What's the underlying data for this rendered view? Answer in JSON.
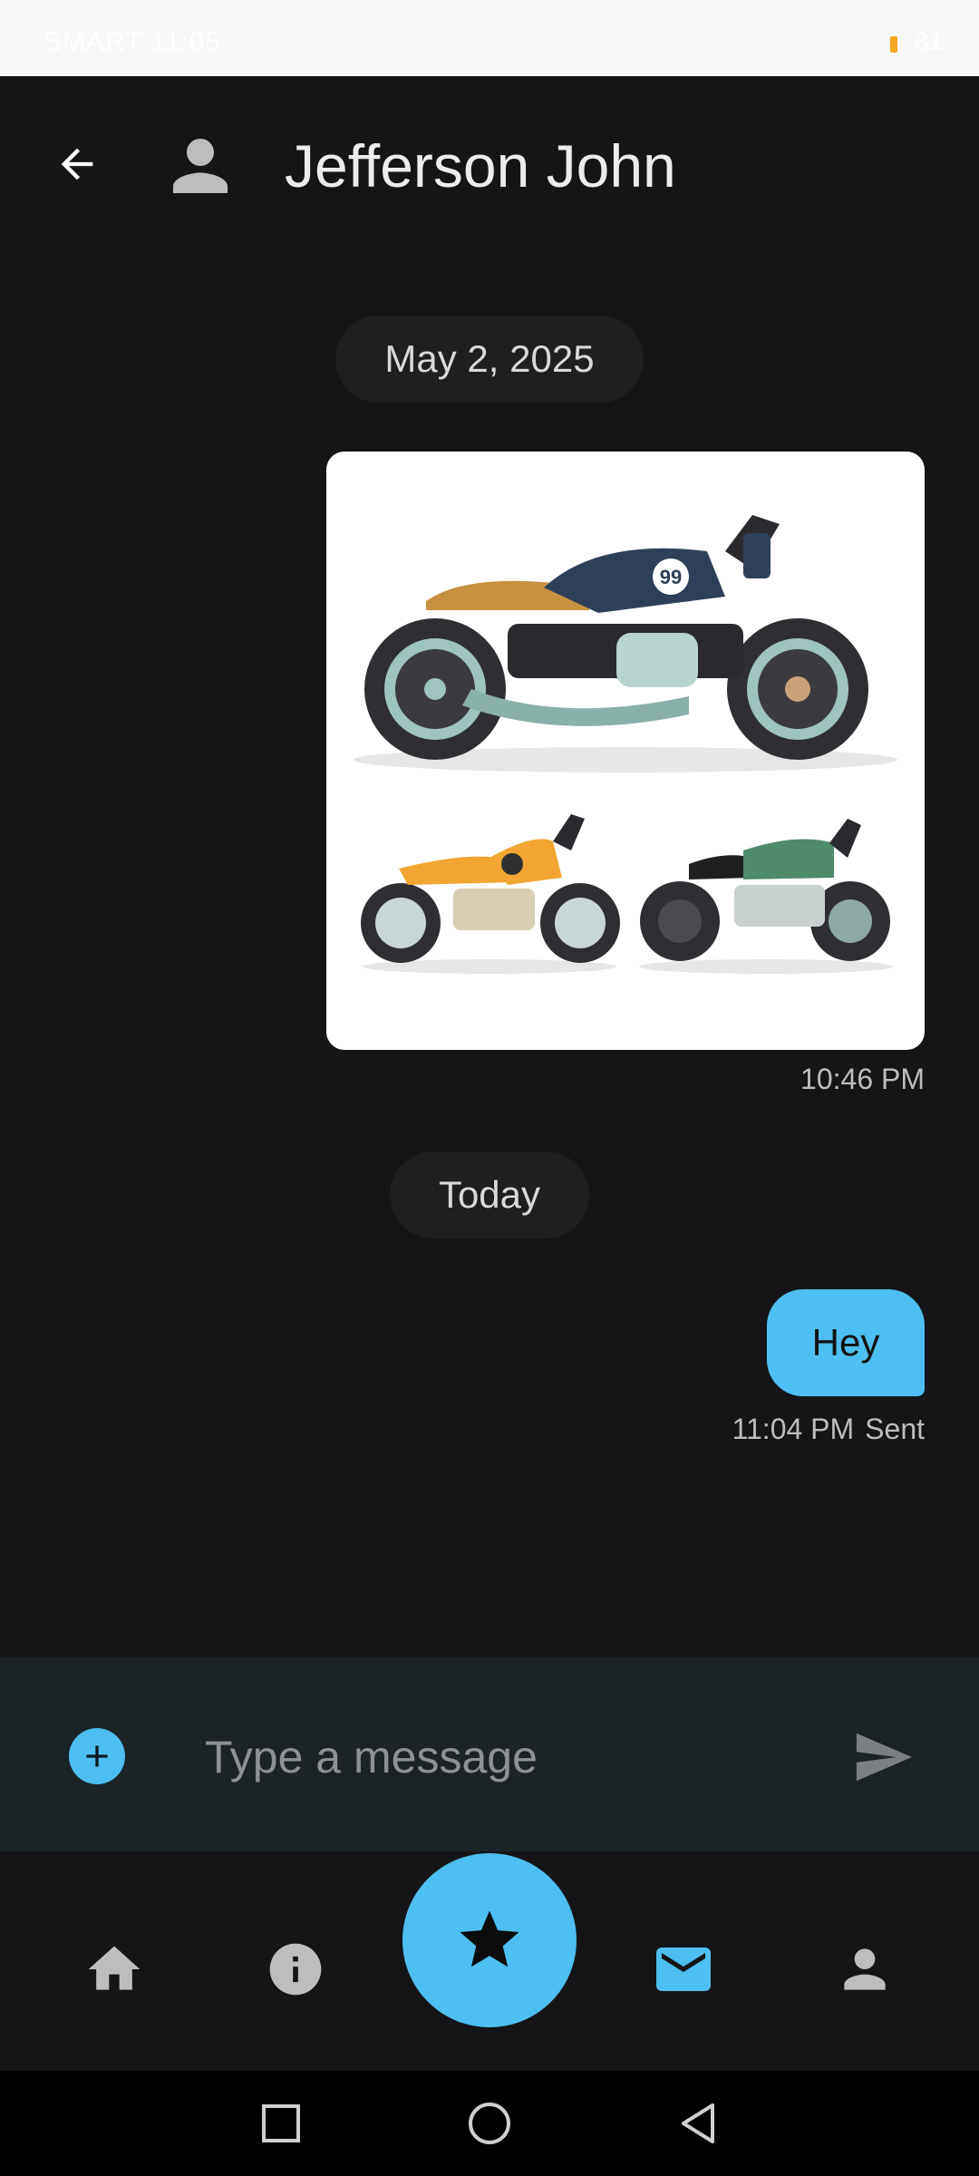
{
  "status_bar": {
    "left_text": "SMART 11:05",
    "right_text": "81"
  },
  "header": {
    "contact_name": "Jefferson John",
    "back_icon": "arrow-back-icon",
    "avatar_icon": "person-icon"
  },
  "conversation": {
    "date_divider_1": "May 2, 2025",
    "image_message_time": "10:46 PM",
    "date_divider_2": "Today",
    "text_message": "Hey",
    "text_message_time": "11:04 PM",
    "text_message_status": "Sent"
  },
  "composer": {
    "placeholder": "Type a message",
    "add_icon": "plus-circle-icon",
    "send_icon": "send-icon"
  },
  "bottom_nav": {
    "items": [
      {
        "icon": "home-icon",
        "active": false
      },
      {
        "icon": "info-icon",
        "active": false
      },
      {
        "icon": "star-icon",
        "active": false
      },
      {
        "icon": "mail-icon",
        "active": true
      },
      {
        "icon": "person-icon",
        "active": false
      }
    ]
  },
  "system_nav": [
    "recents-square-icon",
    "home-circle-icon",
    "back-triangle-icon"
  ],
  "colors": {
    "accent": "#4dbff2",
    "background": "#151517",
    "composer": "#1b2327",
    "chip": "#1f1f21"
  }
}
